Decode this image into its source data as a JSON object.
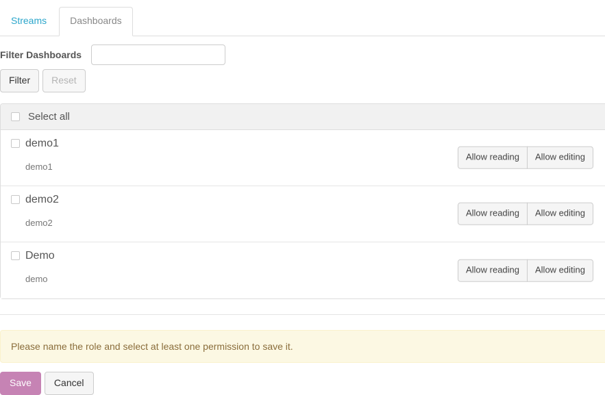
{
  "tabs": [
    {
      "label": "Streams",
      "active": false
    },
    {
      "label": "Dashboards",
      "active": true
    }
  ],
  "filter": {
    "label": "Filter Dashboards",
    "input_value": "",
    "input_placeholder": "",
    "filter_button": "Filter",
    "reset_button": "Reset"
  },
  "list": {
    "select_all_label": "Select all",
    "select_all_checked": false,
    "items": [
      {
        "title": "demo1",
        "description": "demo1",
        "checked": false,
        "read_label": "Allow reading",
        "edit_label": "Allow editing",
        "read_on": false,
        "edit_on": false
      },
      {
        "title": "demo2",
        "description": "demo2",
        "checked": false,
        "read_label": "Allow reading",
        "edit_label": "Allow editing",
        "read_on": false,
        "edit_on": false
      },
      {
        "title": "Demo",
        "description": "demo",
        "checked": false,
        "read_label": "Allow reading",
        "edit_label": "Allow editing",
        "read_on": false,
        "edit_on": false
      }
    ]
  },
  "alert": {
    "message": "Please name the role and select at least one permission to save it."
  },
  "footer": {
    "save_label": "Save",
    "cancel_label": "Cancel"
  },
  "colors": {
    "link": "#2ba6cb",
    "primary": "#ba68a4",
    "alert_bg": "#fcf8e3",
    "alert_text": "#8a6d3b",
    "header_bg": "#f1f1f1",
    "border": "#dddddd"
  }
}
